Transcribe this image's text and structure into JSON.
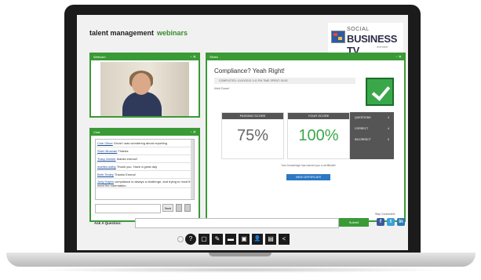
{
  "header": {
    "brand": "talent management",
    "brand_suffix": "webinars",
    "partner_logo": {
      "top": "SOCIAL",
      "main": "BUSINESS TV",
      "tag": "member"
    }
  },
  "webcam": {
    "title": "Webcam",
    "controls": "▫ ✕"
  },
  "chat": {
    "title": "Chat",
    "controls": "▫ ✕",
    "messages": [
      {
        "name": "Cole Oliver",
        "text": "Great I was wondering about reporting"
      },
      {
        "name": "Sheri Brosnan",
        "text": "Thanks"
      },
      {
        "name": "Tracy Zahner",
        "text": "thanks emma!!"
      },
      {
        "name": "marites kathy",
        "text": "Thank you. Have a great day"
      },
      {
        "name": "Beth Tealey",
        "text": "Thanks Emma!"
      },
      {
        "name": "Judy Hayes",
        "text": "compliance is always a challenge, and trying to most that need the information."
      }
    ],
    "send_label": "Send"
  },
  "slides": {
    "title": "Slides",
    "controls": "▫ ✕",
    "heading": "Compliance? Yeah Right!",
    "meta": "COMPLETED: 10/10/2013 1:41 PM     TIME SPENT: 00:00",
    "sub": "Well Done!",
    "passing_label": "PASSING SCORE",
    "passing_value": "75%",
    "your_label": "YOUR SCORE",
    "your_value": "100%",
    "stats": [
      {
        "label": "QUESTIONS",
        "value": "4"
      },
      {
        "label": "CORRECT",
        "value": "4"
      },
      {
        "label": "INCORRECT",
        "value": "0"
      }
    ],
    "earned": "Your knowledge has earned you a certificate!",
    "cert_button": "VIEW CERTIFICATE"
  },
  "ask": {
    "label": "Ask A Question:",
    "placeholder": "",
    "submit": "Submit"
  },
  "social": {
    "label": "Stay Connected:",
    "fb": "f",
    "tw": "t",
    "li": "in"
  },
  "toolbar": {
    "icons": [
      "?",
      "▢",
      "✎",
      "▬",
      "▣",
      "👤",
      "▤",
      "<"
    ]
  },
  "colors": {
    "accent": "#3a9a35",
    "frame": "#1b1b1b",
    "button_blue": "#2b78c4"
  }
}
